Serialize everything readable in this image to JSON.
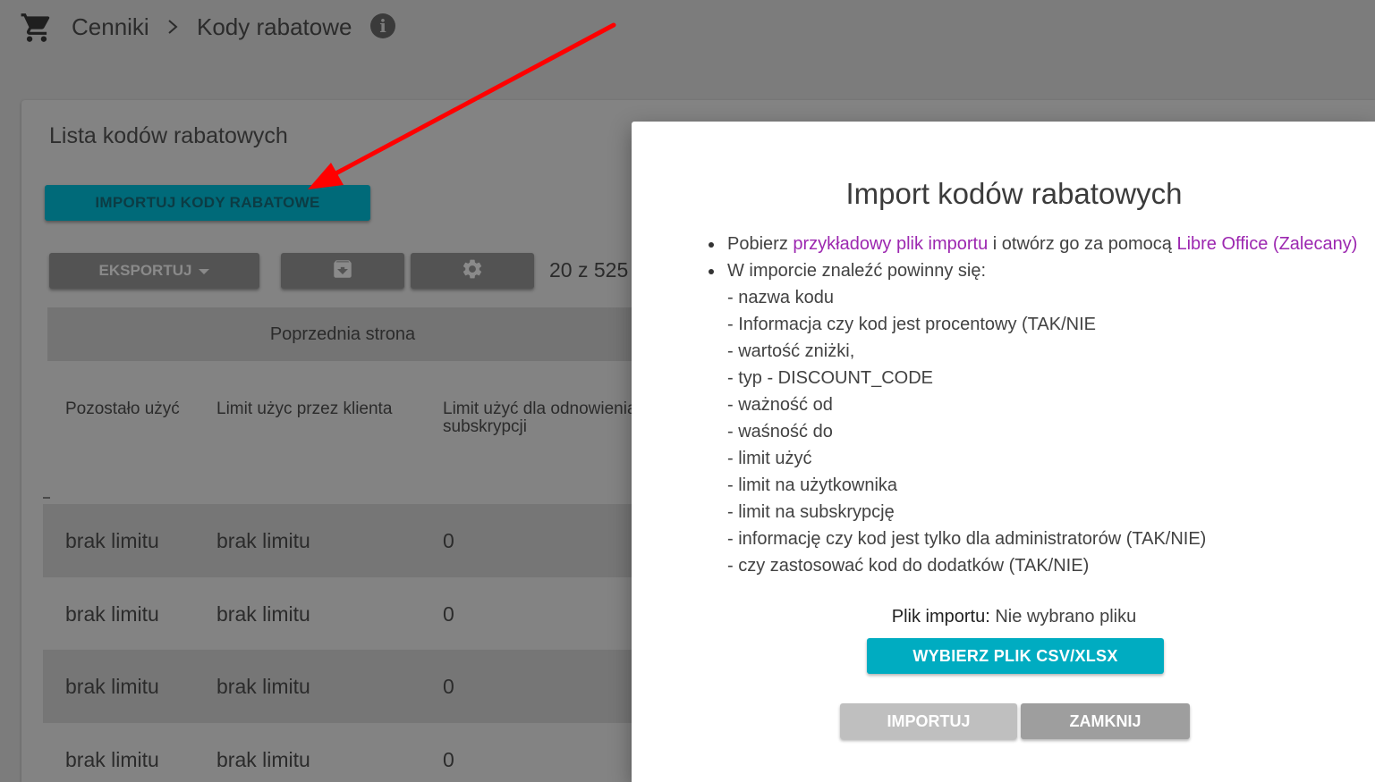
{
  "breadcrumb": {
    "icon": "shopping-cart-icon",
    "items": [
      "Cenniki",
      "Kody rabatowe"
    ],
    "info_icon": "info-icon"
  },
  "card": {
    "title": "Lista kodów rabatowych",
    "import_codes_label": "IMPORTUJ KODY RABATOWE",
    "export_label": "EKSPORTUJ",
    "archive_icon": "archive-icon",
    "settings_icon": "gear-icon",
    "count": "20 z 525",
    "prev_page_label": "Poprzednia strona",
    "table": {
      "headers": [
        "Pozostało użyć",
        "Limit użyc przez klienta",
        "Limit użyć dla odnowienia subskrypcji"
      ],
      "rows": [
        [
          "brak limitu",
          "brak limitu",
          "0"
        ],
        [
          "brak limitu",
          "brak limitu",
          "0"
        ],
        [
          "brak limitu",
          "brak limitu",
          "0"
        ],
        [
          "brak limitu",
          "brak limitu",
          "0"
        ]
      ]
    }
  },
  "modal": {
    "title": "Import kodów rabatowych",
    "line1_a": "Pobierz ",
    "line1_link": "przykładowy plik importu",
    "line1_b": " i otwórz go za pomocą ",
    "line1_link2": "Libre Office (Zalecany)",
    "line2": "W imporcie znaleźć powinny się:",
    "fields": [
      "- nazwa kodu",
      "- Informacja czy kod jest procentowy (TAK/NIE",
      "- wartość zniżki,",
      "- typ - DISCOUNT_CODE",
      "- ważność od",
      "- waśność do",
      "- limit użyć",
      "- limit na użytkownika",
      "- limit na subskrypcję",
      "- informację czy kod jest tylko dla administratorów (TAK/NIE)",
      "- czy zastosować kod do dodatków (TAK/NIE)"
    ],
    "file_label": "Plik importu:",
    "file_value": "Nie wybrano pliku",
    "choose_file_label": "WYBIERZ PLIK CSV/XLSX",
    "import_label": "IMPORTUJ",
    "close_label": "ZAMKNIJ"
  },
  "colors": {
    "accent": "#00acc1",
    "link": "#9c27b0",
    "annotation_arrow": "#ff0000"
  }
}
